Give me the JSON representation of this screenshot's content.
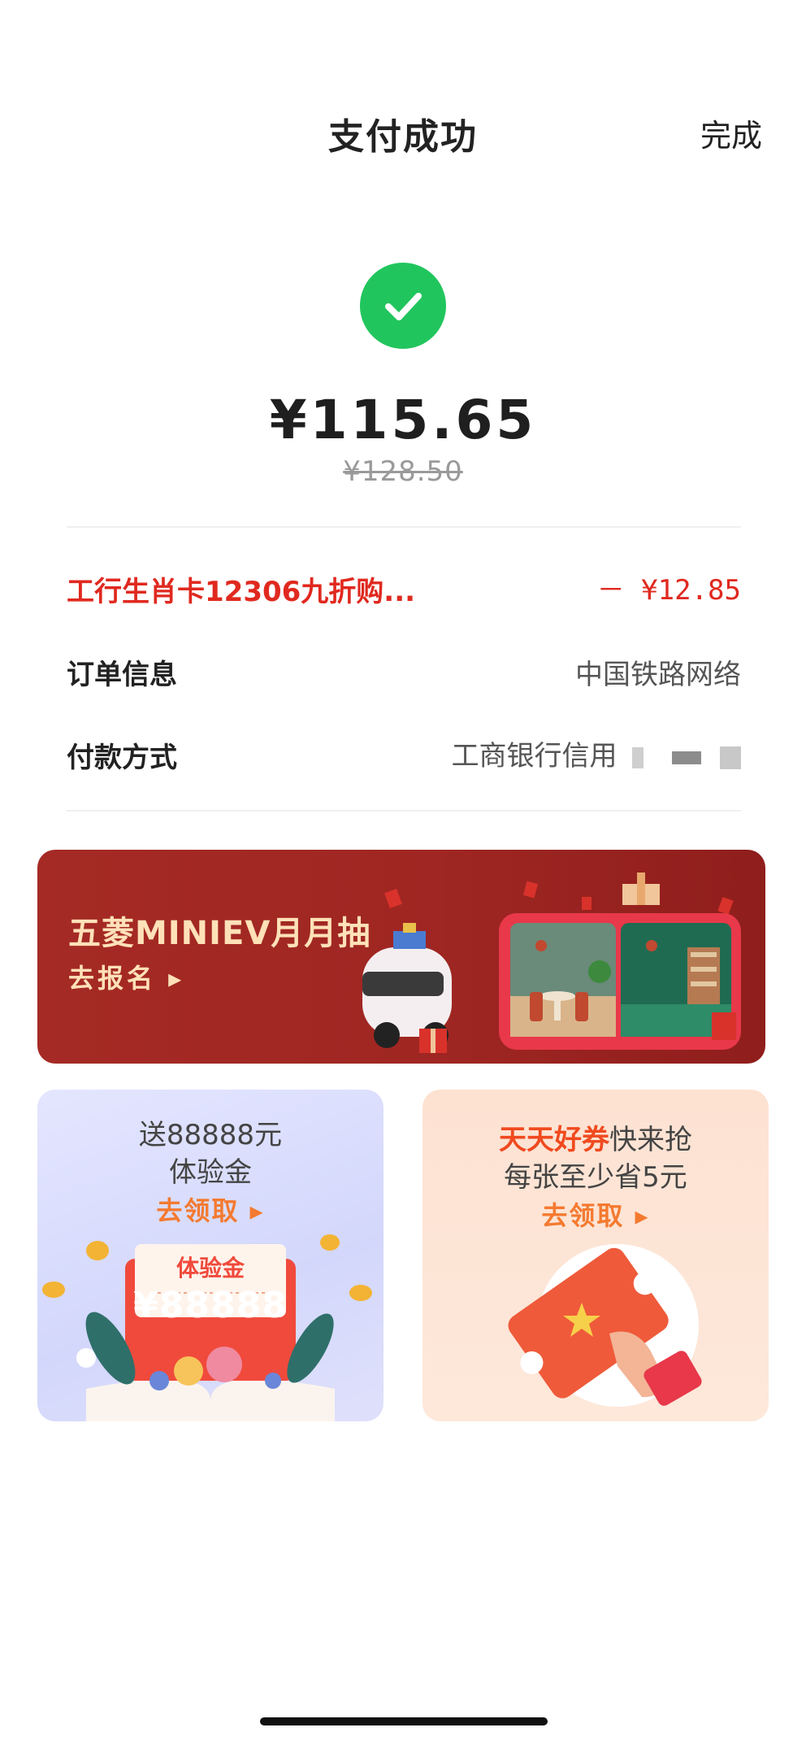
{
  "header": {
    "title": "支付成功",
    "done_label": "完成"
  },
  "payment": {
    "amount": "¥115.65",
    "original_amount": "¥128.50"
  },
  "rows": {
    "promo": {
      "label": "工行生肖卡12306九折购...",
      "value": "－ ¥12.85"
    },
    "order": {
      "label": "订单信息",
      "value": "中国铁路网络"
    },
    "method": {
      "label": "付款方式",
      "value": "工商银行信用"
    }
  },
  "banner": {
    "title": "五菱MINIEV月月抽",
    "cta": "去报名 ▸"
  },
  "cards": {
    "left": {
      "line1": "送88888元",
      "line2": "体验金",
      "cta": "去领取 ▸",
      "envelope_title": "体验金",
      "envelope_amount": "¥88888"
    },
    "right": {
      "line1_highlight": "天天好券",
      "line1_rest": "快来抢",
      "line2": "每张至少省5元",
      "cta": "去领取 ▸"
    }
  },
  "colors": {
    "success": "#21c55d",
    "promo_red": "#e0291f",
    "banner_red": "#a52a25",
    "cta_orange": "#f47a30"
  },
  "icons": {
    "success": "check-icon",
    "banner_arrow": "triangle-right-icon"
  }
}
